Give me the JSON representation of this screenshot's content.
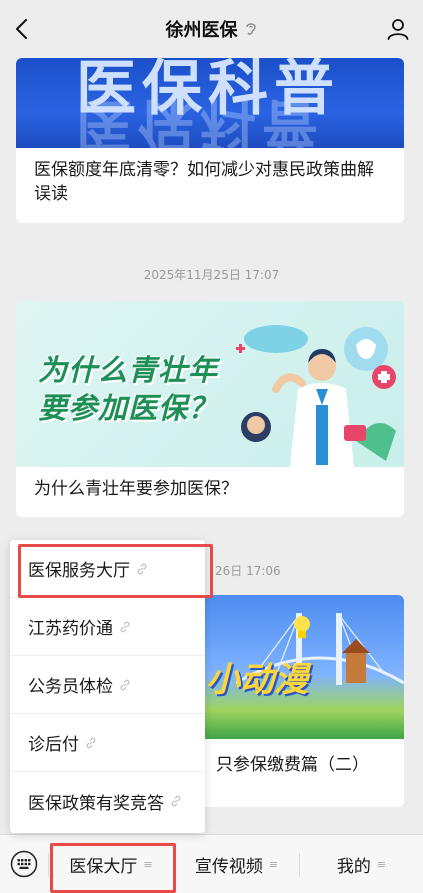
{
  "header": {
    "title": "徐州医保"
  },
  "feed": {
    "card1": {
      "banner_text": "医保科普",
      "title": "医保额度年底清零？如何减少对惠民政策曲解误读"
    },
    "timestamp1": "2025年11月25日 17:07",
    "card2": {
      "banner_line1": "为什么青壮年",
      "banner_line2": "要参加医保？",
      "title": "为什么青壮年要参加医保？"
    },
    "timestamp2_visible": "26日 17:06",
    "card3": {
      "banner_text": "小动漫",
      "title_visible": "只参保缴费篇（二）"
    }
  },
  "popup_menu": {
    "items": [
      "医保服务大厅",
      "江苏药价通",
      "公务员体检",
      "诊后付",
      "医保政策有奖竞答"
    ]
  },
  "bottom_bar": {
    "tabs": [
      "医保大厅",
      "宣传视频",
      "我的"
    ],
    "menu_glyph": "≡"
  },
  "colors": {
    "highlight": "#e84a4a",
    "background": "#ededed"
  }
}
